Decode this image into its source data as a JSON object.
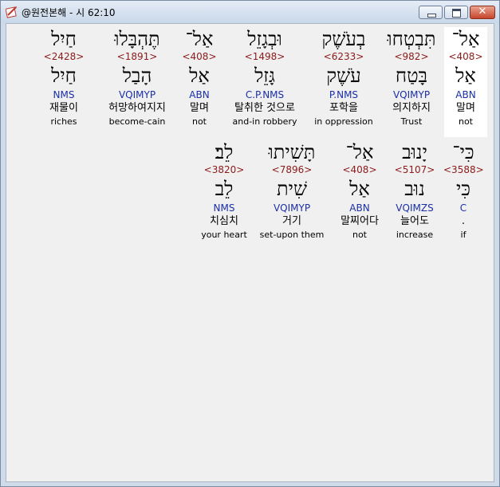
{
  "window": {
    "title": "@원전본해 - 시 62:10"
  },
  "words": [
    {
      "hebrew": "אַל־",
      "strong": "<408>",
      "root": "אַל",
      "morph": "ABN",
      "korean": "말며",
      "english": "not"
    },
    {
      "hebrew": "תִּבְטְחוּ",
      "strong": "<982>",
      "root": "בָּטַח",
      "morph": "VQIMYP",
      "korean": "의지하지",
      "english": "Trust"
    },
    {
      "hebrew": "בְעֹשֶׁק",
      "strong": "<6233>",
      "root": "עֹשֶׁק",
      "morph": "P.NMS",
      "korean": "포학을",
      "english": "in oppression"
    },
    {
      "hebrew": "וּבְגָזֵל",
      "strong": "<1498>",
      "root": "גָּזֵל",
      "morph": "C.P.NMS",
      "korean": "탈취한 것으로",
      "english": "and-in robbery"
    },
    {
      "hebrew": "אַל־",
      "strong": "<408>",
      "root": "אַל",
      "morph": "ABN",
      "korean": "말며",
      "english": "not"
    },
    {
      "hebrew": "תֶּהְבָּלוּ",
      "strong": "<1891>",
      "root": "הָבַל",
      "morph": "VQIMYP",
      "korean": "허망하여지지",
      "english": "become-cain"
    },
    {
      "hebrew": "חַיִל",
      "strong": "<2428>",
      "root": "חַיִל",
      "morph": "NMS",
      "korean": "재물이",
      "english": "riches"
    },
    {
      "hebrew": "כִּי־",
      "strong": "<3588>",
      "root": "כִּי",
      "morph": "C",
      "korean": ".",
      "english": "if"
    },
    {
      "hebrew": "יָנוּב",
      "strong": "<5107>",
      "root": "נוּב",
      "morph": "VQIMZS",
      "korean": "늘어도",
      "english": "increase"
    },
    {
      "hebrew": "אַל־",
      "strong": "<408>",
      "root": "אַל",
      "morph": "ABN",
      "korean": "말찌어다",
      "english": "not"
    },
    {
      "hebrew": "תָּשִׁיתוּ",
      "strong": "<7896>",
      "root": "שִׁית",
      "morph": "VQIMYP",
      "korean": "거기",
      "english": "set-upon them"
    },
    {
      "hebrew": "לֵב׃",
      "strong": "<3820>",
      "root": "לֵב",
      "morph": "NMS",
      "korean": "치심치",
      "english": "your heart"
    }
  ]
}
